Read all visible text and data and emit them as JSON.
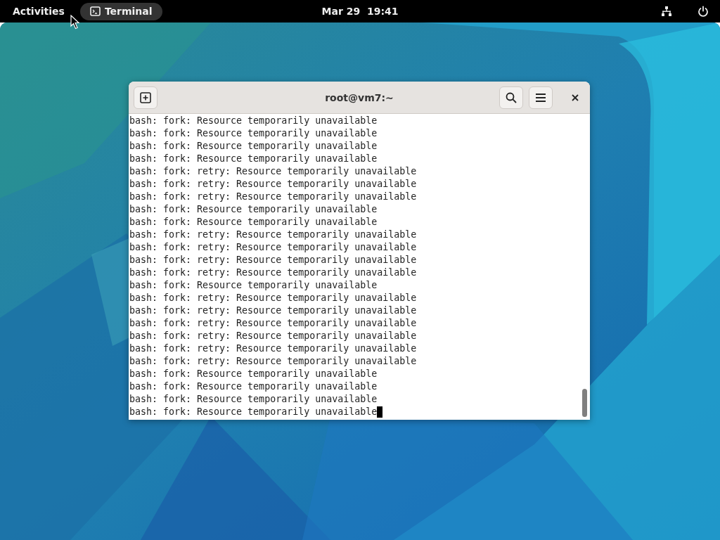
{
  "top_bar": {
    "activities": "Activities",
    "app_menu": "Terminal",
    "clock": "Mar 29  19:41"
  },
  "window": {
    "title": "root@vm7:~",
    "lines": [
      "bash: fork: Resource temporarily unavailable",
      "bash: fork: Resource temporarily unavailable",
      "bash: fork: Resource temporarily unavailable",
      "bash: fork: Resource temporarily unavailable",
      "bash: fork: retry: Resource temporarily unavailable",
      "bash: fork: retry: Resource temporarily unavailable",
      "bash: fork: retry: Resource temporarily unavailable",
      "bash: fork: Resource temporarily unavailable",
      "bash: fork: Resource temporarily unavailable",
      "bash: fork: retry: Resource temporarily unavailable",
      "bash: fork: retry: Resource temporarily unavailable",
      "bash: fork: retry: Resource temporarily unavailable",
      "bash: fork: retry: Resource temporarily unavailable",
      "bash: fork: Resource temporarily unavailable",
      "bash: fork: retry: Resource temporarily unavailable",
      "bash: fork: retry: Resource temporarily unavailable",
      "bash: fork: retry: Resource temporarily unavailable",
      "bash: fork: retry: Resource temporarily unavailable",
      "bash: fork: retry: Resource temporarily unavailable",
      "bash: fork: retry: Resource temporarily unavailable",
      "bash: fork: Resource temporarily unavailable",
      "bash: fork: Resource temporarily unavailable",
      "bash: fork: Resource temporarily unavailable",
      "bash: fork: Resource temporarily unavailable"
    ]
  }
}
